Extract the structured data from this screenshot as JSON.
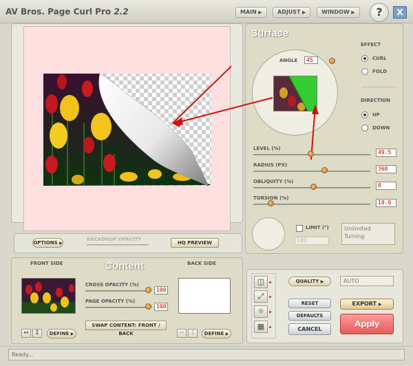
{
  "app": {
    "title": "AV Bros. Page Curl Pro",
    "version": "2.2"
  },
  "menu": {
    "main": "MAIN",
    "adjust": "ADJUST",
    "window": "WINDOW",
    "help": "?",
    "close": "X"
  },
  "preview": {
    "options_label": "OPTIONS",
    "backdrop_opacity_label": "BACKDROP OPACITY",
    "hq_preview_label": "HQ PREVIEW",
    "background_color": "#ffe0e0"
  },
  "surface": {
    "heading": "Surface",
    "angle_label": "ANGLE",
    "angle_value": "45",
    "effect_label": "EFFECT",
    "effect_options": [
      "CURL",
      "FOLD"
    ],
    "effect_selected": "CURL",
    "direction_label": "DIRECTION",
    "direction_options": [
      "UP",
      "DOWN"
    ],
    "direction_selected": "UP",
    "level_label": "LEVEL (%)",
    "level_value": "49.5",
    "radius_label": "RADIUS (PX)",
    "radius_value": "360",
    "obliquity_label": "OBLIQUITY (%)",
    "obliquity_value": "0",
    "torsion_label": "TORSION (%)",
    "torsion_value": "10.0",
    "limit_label": "LIMIT (°)",
    "limit_value": "180",
    "limit_status": "Unlimited Turning",
    "highlight_color": "#33cc33"
  },
  "content": {
    "heading": "Content",
    "front_side_label": "FRONT SIDE",
    "back_side_label": "BACK SIDE",
    "cross_opacity_label": "CROSS OPACITY (%)",
    "cross_opacity_value": "100",
    "page_opacity_label": "PAGE OPACITY (%)",
    "page_opacity_value": "100",
    "swap_label": "SWAP CONTENT: FRONT / BACK",
    "define_label": "DEFINE"
  },
  "actions": {
    "quality_label": "QUALITY",
    "quality_value": "AUTO",
    "reset_label": "RESET",
    "defaults_label": "DEFAULTS",
    "cancel_label": "CANCEL",
    "export_label": "EXPORT",
    "apply_label": "Apply",
    "apply_color": "#f06a6a"
  },
  "status": {
    "text": "Ready..."
  },
  "icons": {
    "swap_horizontal": "↔",
    "swap_vertical": "↕",
    "tool_1": "◫",
    "tool_2": "⤢",
    "tool_3": "☼",
    "tool_4": "▦"
  }
}
